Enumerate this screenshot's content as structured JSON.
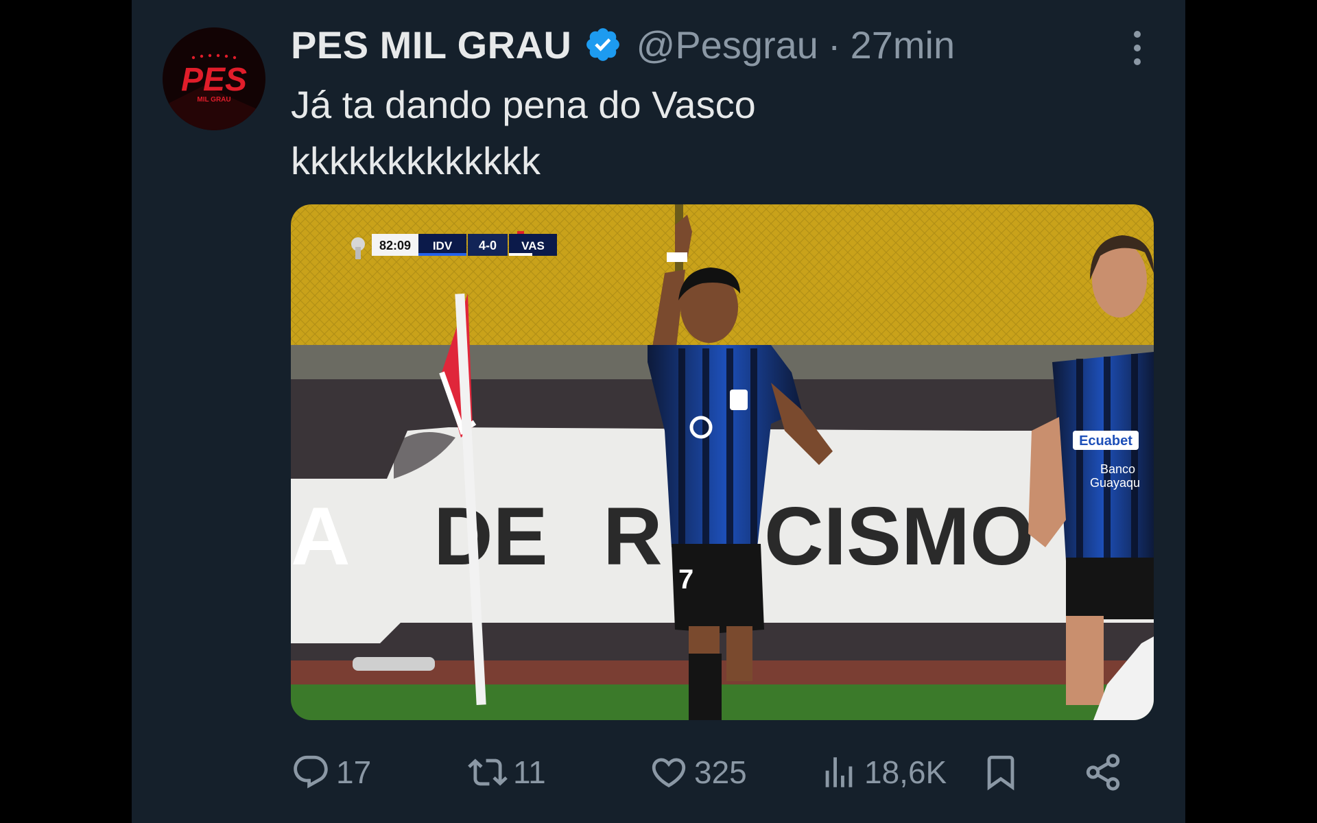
{
  "tweet": {
    "author_name": "PES MIL GRAU",
    "handle": "@Pesgrau",
    "separator": "·",
    "time": "27min",
    "text_lines": [
      "Já ta dando pena do Vasco",
      "kkkkkkkkkkkkk"
    ],
    "avatar": {
      "logo_text": "PES",
      "logo_subtext": "MIL GRAU",
      "accent_color": "#e11d2a"
    },
    "verified_color": "#1d9bf0"
  },
  "media": {
    "scoreboard": {
      "clock": "82:09",
      "home": "IDV",
      "score": "4-0",
      "away": "VAS"
    },
    "banner_text_left": "A",
    "banner_text_de": "DE",
    "banner_text_r": "R",
    "banner_text_cismo": "CISMO",
    "jersey_number": "7",
    "sponsor_1": "Ecuabet",
    "sponsor_2_line1": "Banco",
    "sponsor_2_line2": "Guayaqu"
  },
  "actions": {
    "replies": "17",
    "retweets": "11",
    "likes": "325",
    "views": "18,6K"
  },
  "icons": {
    "reply": "reply-icon",
    "retweet": "retweet-icon",
    "like": "heart-icon",
    "views": "views-icon",
    "bookmark": "bookmark-icon",
    "share": "share-icon",
    "more": "more-options-icon",
    "verified": "verified-badge-icon"
  },
  "colors": {
    "background": "#15202b",
    "text_primary": "#e7e9ea",
    "text_secondary": "#8b98a5"
  }
}
